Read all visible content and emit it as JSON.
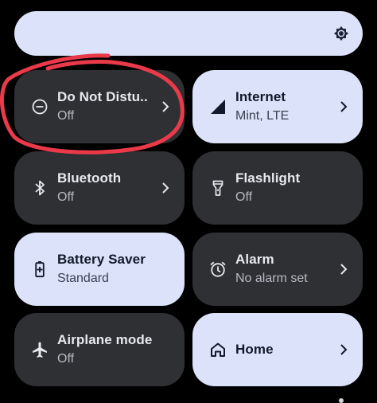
{
  "colors": {
    "background": "#000000",
    "tile_dark": "#2f3034",
    "tile_light": "#dbe2f9",
    "annotation_red": "#ea3a4a"
  },
  "brightness": {
    "icon": "brightness-icon"
  },
  "tiles": [
    {
      "label": "Do Not Distu..",
      "sub": "Off",
      "state": "off",
      "icon": "do-not-disturb-icon",
      "chevron": true
    },
    {
      "label": "Internet",
      "sub": "Mint, LTE",
      "state": "on",
      "icon": "cellular-signal-icon",
      "chevron": true
    },
    {
      "label": "Bluetooth",
      "sub": "Off",
      "state": "off",
      "icon": "bluetooth-icon",
      "chevron": true
    },
    {
      "label": "Flashlight",
      "sub": "Off",
      "state": "off",
      "icon": "flashlight-icon",
      "chevron": false
    },
    {
      "label": "Battery Saver",
      "sub": "Standard",
      "state": "on",
      "icon": "battery-saver-icon",
      "chevron": false
    },
    {
      "label": "Alarm",
      "sub": "No alarm set",
      "state": "off",
      "icon": "alarm-icon",
      "chevron": true
    },
    {
      "label": "Airplane mode",
      "sub": "Off",
      "state": "off",
      "icon": "airplane-icon",
      "chevron": false
    },
    {
      "label": "Home",
      "sub": "",
      "state": "on",
      "icon": "home-icon",
      "chevron": true
    }
  ]
}
